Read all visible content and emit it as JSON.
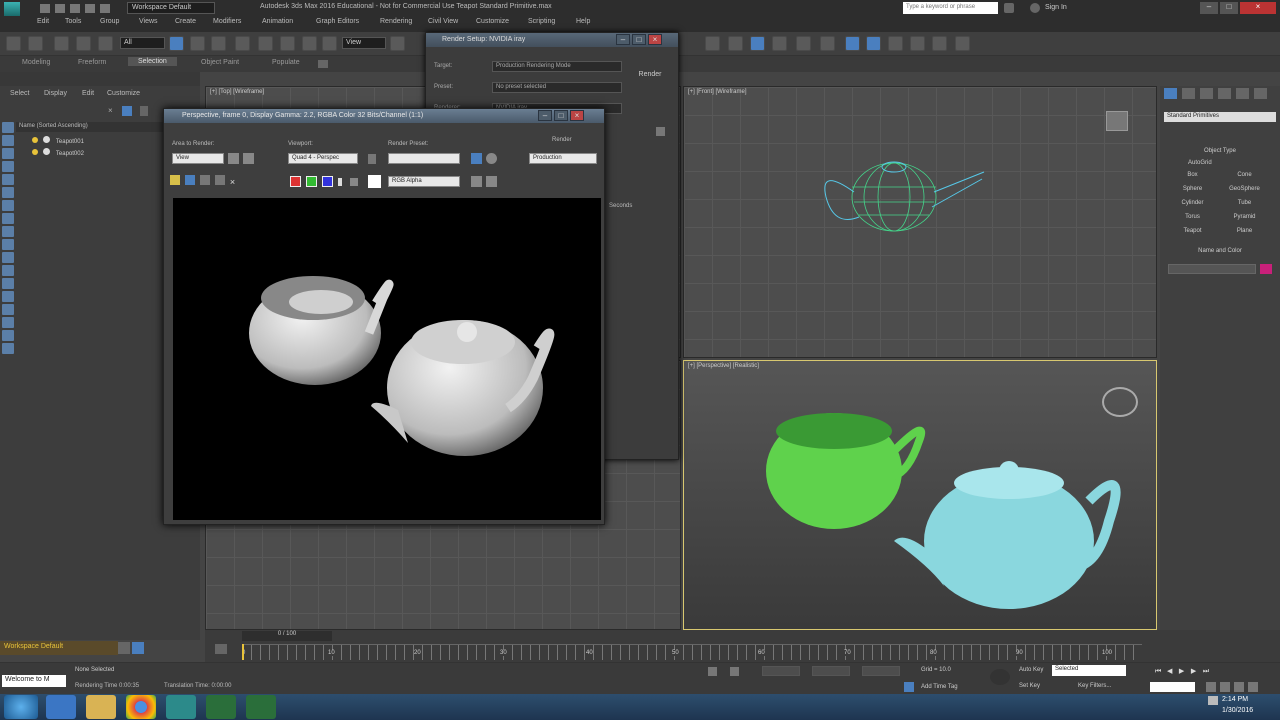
{
  "app": {
    "workspace": "Workspace Default",
    "window_title": "Autodesk 3ds Max 2016 Educational - Not for Commercial Use   Teapot Standard Primitive.max",
    "search_placeholder": "Type a keyword or phrase",
    "sign_in": "Sign In"
  },
  "menu": [
    "Edit",
    "Tools",
    "Group",
    "Views",
    "Create",
    "Modifiers",
    "Animation",
    "Graph Editors",
    "Rendering",
    "Civil View",
    "Customize",
    "Scripting",
    "Help"
  ],
  "toolbar": {
    "filter": "All",
    "view": "View"
  },
  "ribbon": {
    "tabs": [
      "Modeling",
      "Freeform",
      "Selection",
      "Object Paint",
      "Populate"
    ],
    "selected": "Selection"
  },
  "scene_explorer": {
    "tabs": [
      "Select",
      "Display",
      "Edit",
      "Customize"
    ],
    "column": "Name (Sorted Ascending)",
    "items": [
      "Teapot001",
      "Teapot002"
    ]
  },
  "viewports": {
    "top": "[+] [Top] [Wireframe]",
    "front": "[+] [Front] [Wireframe]",
    "perspective": "[+] [Perspective] [Realistic]"
  },
  "render_setup": {
    "title": "Render Setup: NVIDIA iray",
    "target_label": "Target:",
    "target_value": "Production Rendering Mode",
    "preset_label": "Preset:",
    "preset_value": "No preset selected",
    "renderer_label": "Renderer:",
    "renderer_value": "NVIDIA iray",
    "render_button": "Render",
    "seconds": "Seconds"
  },
  "frame_buffer": {
    "title": "Perspective, frame 0, Display Gamma: 2.2, RGBA Color 32 Bits/Channel (1:1)",
    "area_label": "Area to Render:",
    "area_value": "View",
    "viewport_label": "Viewport:",
    "viewport_value": "Quad 4 - Perspec",
    "preset_label": "Render Preset:",
    "preset_value": "",
    "render_label": "Render",
    "render_value": "Production",
    "channel_value": "RGB Alpha"
  },
  "command_panel": {
    "category": "Standard Primitives",
    "object_type": "Object Type",
    "autogrid": "AutoGrid",
    "buttons": [
      "Box",
      "Cone",
      "Sphere",
      "GeoSphere",
      "Cylinder",
      "Tube",
      "Torus",
      "Pyramid",
      "Teapot",
      "Plane"
    ],
    "name_color": "Name and Color",
    "object_color": "#c8207a"
  },
  "timeline": {
    "frame": "0 / 100",
    "ticks": [
      "0",
      "10",
      "20",
      "30",
      "40",
      "50",
      "60",
      "70",
      "80",
      "90",
      "100"
    ]
  },
  "status": {
    "workspace": "Workspace Default",
    "welcome": "Welcome to M",
    "selection": "None Selected",
    "render_time": "Rendering Time 0:00:35",
    "translation_time": "Translation Time: 0:00:00",
    "grid": "Grid = 10.0",
    "add_time_tag": "Add Time Tag",
    "auto_key": "Auto Key",
    "selected": "Selected",
    "set_key": "Set Key",
    "key_filters": "Key Filters...",
    "clock_time": "2:14 PM",
    "clock_date": "1/30/2016"
  }
}
